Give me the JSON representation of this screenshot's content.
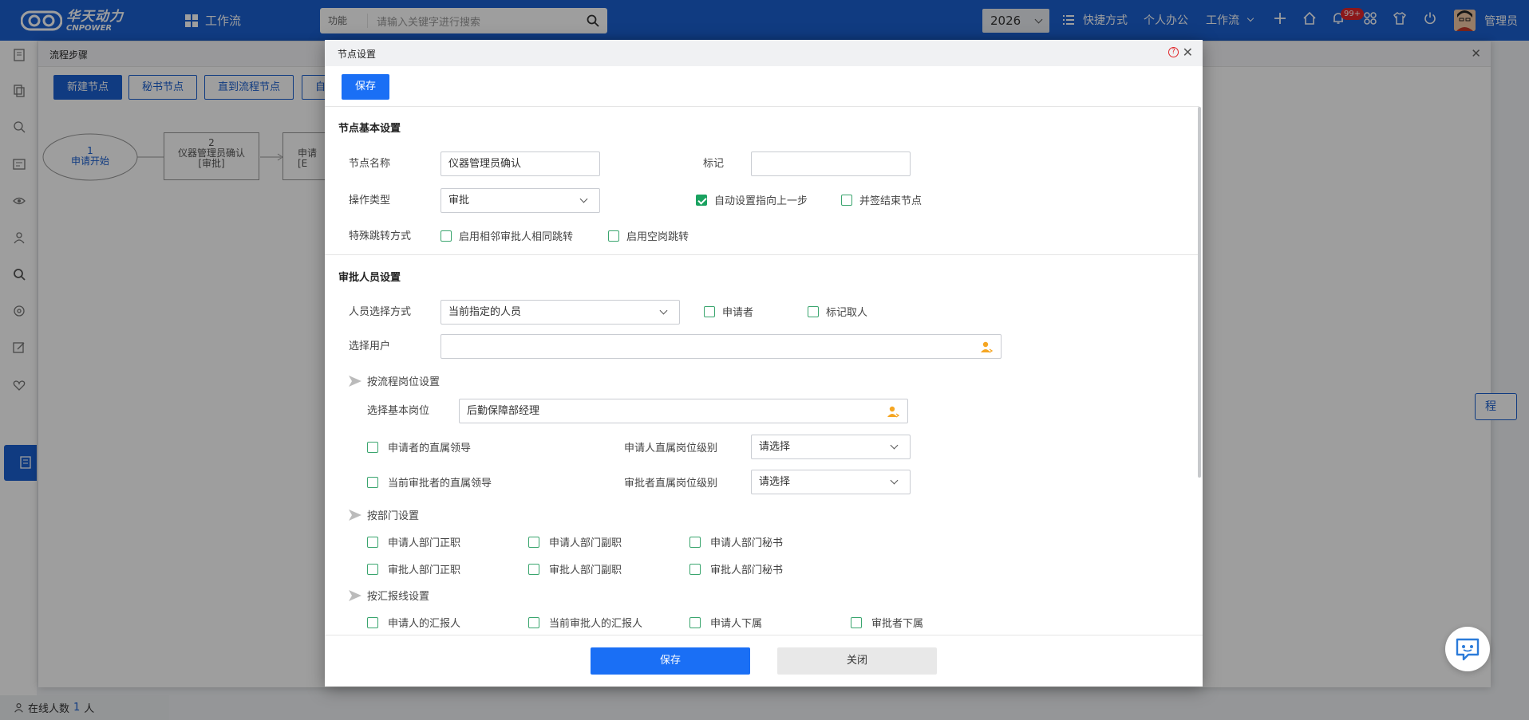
{
  "colors": {
    "brand": "#1a5fd0",
    "primary_button": "#1a6ff5",
    "checkbox_checked": "#1aa260",
    "badge": "#e0262a"
  },
  "topbar": {
    "logo_cn": "华天动力",
    "logo_en": "CNPOWER",
    "app_label": "工作流",
    "search": {
      "category": "功能",
      "placeholder": "请输入关键字进行搜索"
    },
    "year": "2026",
    "shortcut": "快捷方式",
    "personal_office": "个人办公",
    "workflow_menu": "工作流",
    "notification_badge": "99+",
    "user": "管理员"
  },
  "footer": {
    "online_label": "在线人数",
    "online_count": "1",
    "online_unit": "人"
  },
  "background_panel": {
    "title": "流程步骤",
    "buttons": [
      "新建节点",
      "秘书节点",
      "直到流程节点",
      "自"
    ],
    "flow_start": {
      "num": "1",
      "label": "申请开始"
    },
    "flow_node2": {
      "num": "2",
      "label": "仪器管理员确认",
      "type": "[审批]"
    },
    "flow_node3": {
      "label": "申请",
      "type": "[E"
    },
    "right_button": "程"
  },
  "modal": {
    "title": "节点设置",
    "help_icon": "?",
    "save_top": "保存",
    "basic_section": "节点基本设置",
    "node_name_label": "节点名称",
    "node_name_value": "仪器管理员确认",
    "mark_label": "标记",
    "mark_value": "",
    "op_type_label": "操作类型",
    "op_type_value": "审批",
    "auto_prev_label": "自动设置指向上一步",
    "auto_prev_checked": true,
    "countersign_end_label": "并签结束节点",
    "countersign_end_checked": false,
    "special_jump_label": "特殊跳转方式",
    "adjacent_same_label": "启用相邻审批人相同跳转",
    "empty_post_label": "启用空岗跳转",
    "approver_section": "审批人员设置",
    "select_mode_label": "人员选择方式",
    "select_mode_value": "当前指定的人员",
    "applicant_label": "申请者",
    "marker_label": "标记取人",
    "select_user_label": "选择用户",
    "select_user_value": "",
    "by_post_label": "按流程岗位设置",
    "base_post_label": "选择基本岗位",
    "base_post_value": "后勤保障部经理",
    "applicant_leader_label": "申请者的直属领导",
    "applicant_level_label": "申请人直属岗位级别",
    "applicant_level_value": "请选择",
    "current_leader_label": "当前审批者的直属领导",
    "approver_level_label": "审批者直属岗位级别",
    "approver_level_value": "请选择",
    "by_dept_label": "按部门设置",
    "dept_row1": [
      "申请人部门正职",
      "申请人部门副职",
      "申请人部门秘书"
    ],
    "dept_row2": [
      "审批人部门正职",
      "审批人部门副职",
      "审批人部门秘书"
    ],
    "by_report_label": "按汇报线设置",
    "report_row": [
      "申请人的汇报人",
      "当前审批人的汇报人",
      "申请人下属",
      "审批者下属"
    ],
    "footer_save": "保存",
    "footer_close": "关闭"
  }
}
